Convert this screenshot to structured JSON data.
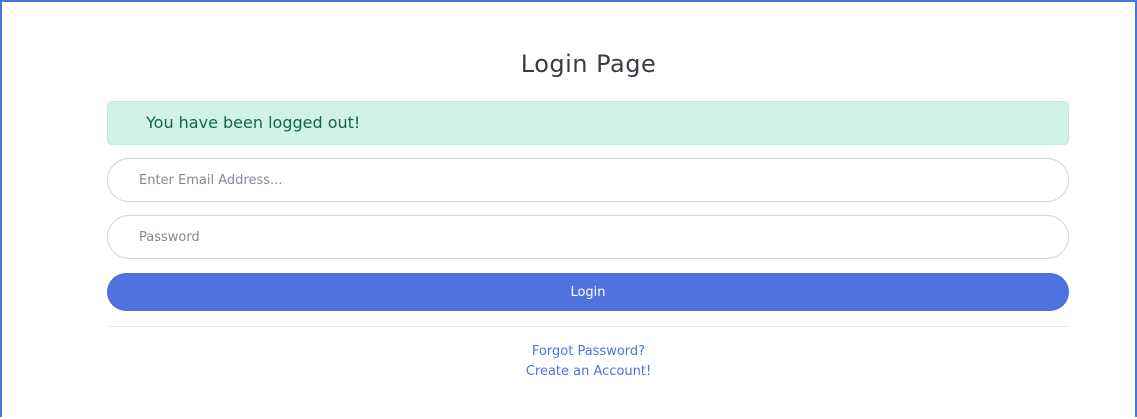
{
  "page": {
    "title": "Login Page"
  },
  "alert": {
    "message": "You have been logged out!"
  },
  "form": {
    "email_placeholder": "Enter Email Address...",
    "email_value": "",
    "password_placeholder": "Password",
    "password_value": "",
    "login_label": "Login"
  },
  "links": {
    "forgot_password": "Forgot Password?",
    "create_account": "Create an Account!"
  },
  "colors": {
    "primary": "#4e73df",
    "alert_bg": "#d1f2e6",
    "alert_text": "#0f6848"
  }
}
